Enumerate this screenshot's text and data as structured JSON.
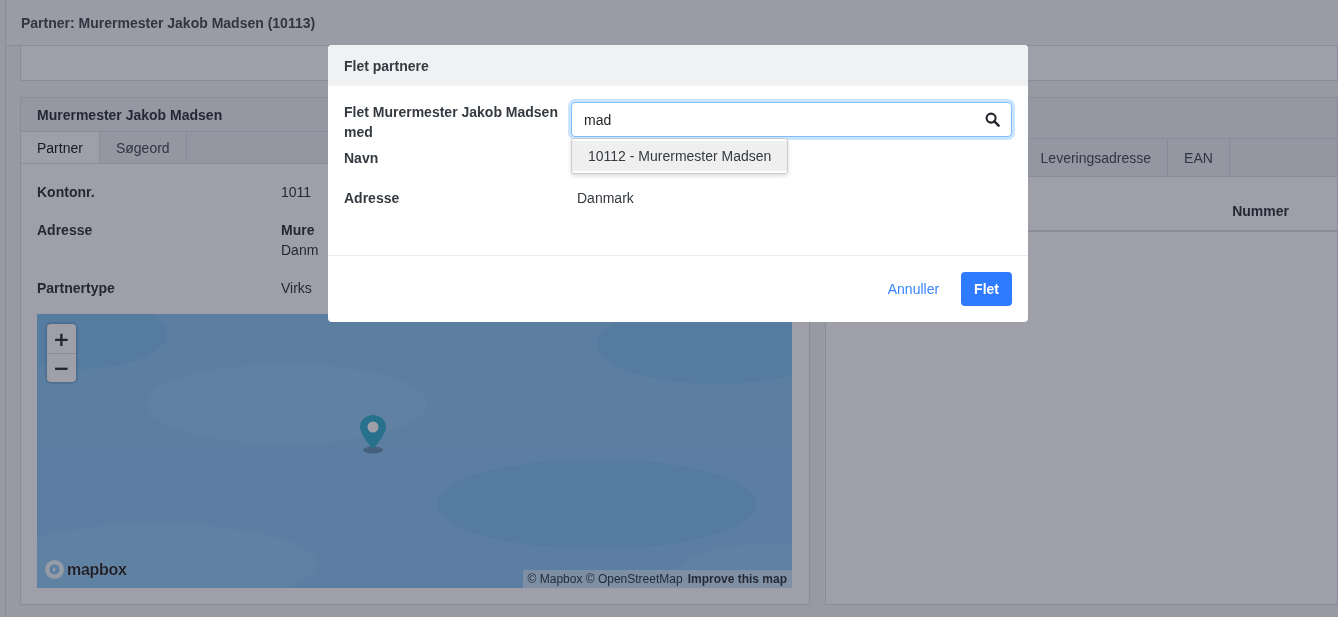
{
  "page": {
    "title": "Partner: Murermester Jakob Madsen (10113)"
  },
  "left_card": {
    "title": "Murermester Jakob Madsen",
    "tabs": [
      {
        "label": "Partner",
        "selected": true
      },
      {
        "label": "Søgeord",
        "selected": false
      }
    ],
    "fields": [
      {
        "label": "Kontonr.",
        "lines": [
          "1011"
        ],
        "bold_first": false
      },
      {
        "label": "Adresse",
        "lines": [
          "Mure",
          "Danm"
        ],
        "bold_first": true
      },
      {
        "label": "Partnertype",
        "lines": [
          "Virks"
        ],
        "bold_first": false
      }
    ],
    "map": {
      "kind": "picture",
      "zoom_in": "+",
      "zoom_out": "−",
      "logo": "mapbox",
      "attribution": "© Mapbox © OpenStreetMap",
      "improve_link": "Improve this map"
    }
  },
  "right_card": {
    "tabs": [
      {
        "label": "Leveringsadresse",
        "selected": false
      },
      {
        "label": "EAN",
        "selected": false
      }
    ],
    "columns": [
      "Nummer"
    ]
  },
  "dialog": {
    "title": "Flet partnere",
    "merge_label": "Flet Murermester Jakob Madsen med",
    "search": {
      "value": "mad"
    },
    "suggestions": [
      {
        "label": "10112 - Murermester Madsen",
        "selected": true
      }
    ],
    "fields": [
      {
        "label": "Navn"
      },
      {
        "label": "Adresse",
        "value": "Danmark"
      }
    ],
    "buttons": [
      {
        "label": "Annuller",
        "kind": "link"
      },
      {
        "label": "Flet",
        "kind": "primary"
      }
    ]
  }
}
